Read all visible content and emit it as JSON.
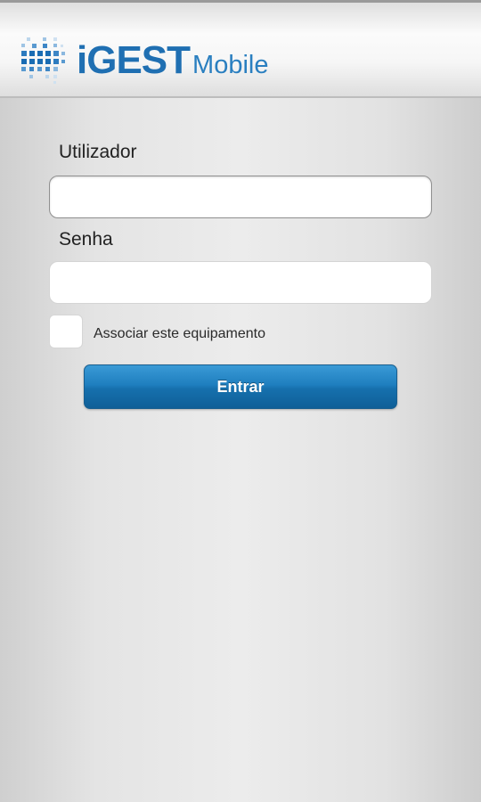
{
  "header": {
    "logo_primary": "iGEST",
    "logo_secondary": "Mobile",
    "logo_mark_icon": "pixel-grid-logo-icon",
    "brand_color": "#1f6fb2"
  },
  "login_form": {
    "username_label": "Utilizador",
    "username_value": "",
    "password_label": "Senha",
    "password_value": "",
    "associate_label": "Associar este equipamento",
    "associate_checked": false,
    "submit_label": "Entrar",
    "button_color": "#1f7fbf"
  }
}
